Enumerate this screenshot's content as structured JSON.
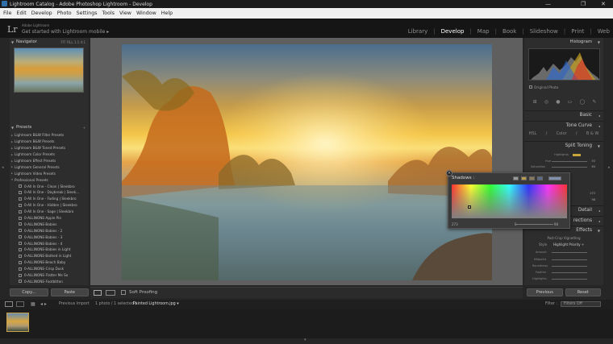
{
  "window": {
    "title": "Lightroom Catalog - Adobe Photoshop Lightroom - Develop",
    "min": "—",
    "max": "❐",
    "close": "✕"
  },
  "menu": [
    "File",
    "Edit",
    "Develop",
    "Photo",
    "Settings",
    "Tools",
    "View",
    "Window",
    "Help"
  ],
  "identity": {
    "logo": "Lr",
    "account": "Adobe Lightroom",
    "mobile": "Get started with Lightroom mobile ▸"
  },
  "modules": [
    "Library",
    "Develop",
    "Map",
    "Book",
    "Slideshow",
    "Print",
    "Web"
  ],
  "active_module": "Develop",
  "left": {
    "navigator": {
      "label": "Navigator",
      "zooms": "FIT   FILL   1:1   4:1"
    },
    "presets": {
      "label": "Presets",
      "add": "+",
      "groups": [
        "Lightroom B&W Filter Presets",
        "Lightroom B&W Presets",
        "Lightroom B&W Toned Presets",
        "Lightroom Color Presets",
        "Lightroom Effect Presets",
        "Lightroom General Presets",
        "Lightroom Video Presets",
        "Professional Presets"
      ],
      "items": [
        "0-All In One - Clean | Sleekbro",
        "0-All In One - Daybreak | Sleek...",
        "0-All In One - Fading | Sleekbro",
        "0-All In One - Hidden | Sleekbro",
        "0-All In One - Sage | Sleekbro",
        "0-ALLINONE-Apple Pie",
        "0-ALLINONE-Babies",
        "0-ALLINONE-Babies - 2",
        "0-ALLINONE-Babies - 3",
        "0-ALLINONE-Babies - 4",
        "0-ALLINONE-Babies in Light",
        "0-ALLINONE-Bathed in Light",
        "0-ALLINONE-Beach Baby",
        "0-ALLINONE-Crisp Dusk",
        "0-ALLINONE-Flatter Me So",
        "0-ALLINONE-Footbitten"
      ]
    },
    "copy": "Copy...",
    "paste": "Paste"
  },
  "toolbar": {
    "soft_proofing": "Soft Proofing"
  },
  "right": {
    "histogram": "Histogram",
    "original": "Original Photo",
    "sections": [
      "Basic",
      "Tone Curve"
    ],
    "hsl_tabs": [
      "HSL",
      "/",
      "Color",
      "/",
      "B & W"
    ],
    "split_toning": "Split Toning",
    "split_rows": [
      {
        "label": "Highlights",
        "value": ""
      },
      {
        "label": "Hue",
        "value": "53"
      },
      {
        "label": "Saturation",
        "value": "64"
      }
    ],
    "partial_values": [
      "273",
      "98"
    ],
    "detail": "Detail",
    "lens": "rections",
    "effects": "Effects",
    "vignette": "Post-Crop Vignetting",
    "style_label": "Style",
    "style_value": "Highlight Priority ÷",
    "effect_rows": [
      "Amount",
      "Midpoint",
      "Roundness",
      "Feather",
      "Highlights"
    ],
    "previous": "Previous",
    "reset": "Reset"
  },
  "popup": {
    "title": "Shadows :",
    "hue_value": "273",
    "s_label": "S",
    "s_value": "98"
  },
  "filmstrip": {
    "views": "1  2",
    "nav": "◂  ▸",
    "source": "Previous Import",
    "count": "1 photo / 1 selected /",
    "filename": "Painted Lightroom.jpg ▾",
    "filter_label": "Filter :",
    "filter_value": "Filters Off"
  }
}
